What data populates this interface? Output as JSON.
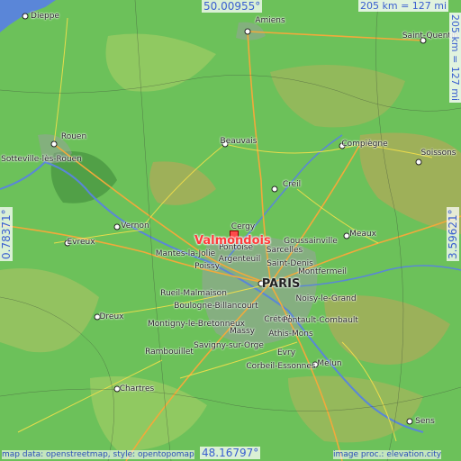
{
  "place": {
    "name": "Valmondois",
    "marker_color": "#ff4a4a"
  },
  "coords": {
    "top": "50.00955°",
    "bottom": "48.16797°",
    "left": "0.78371°",
    "right": "3.59621°"
  },
  "scale": {
    "horizontal": "205 km = 127 mi",
    "vertical": "205 km = 127 mi"
  },
  "attribution": {
    "left": "map data: openstreetmap, style: opentopomap",
    "right": "image proc.: elevation.city"
  },
  "cities": [
    {
      "name": "Dieppe"
    },
    {
      "name": "Amiens"
    },
    {
      "name": "Saint-Quentin"
    },
    {
      "name": "Rouen"
    },
    {
      "name": "Sotteville-lès-Rouen"
    },
    {
      "name": "Beauvais"
    },
    {
      "name": "Compiègne"
    },
    {
      "name": "Soissons"
    },
    {
      "name": "Creil"
    },
    {
      "name": "Vernon"
    },
    {
      "name": "Evreux"
    },
    {
      "name": "Mantes-la-Jolie"
    },
    {
      "name": "Pontoise"
    },
    {
      "name": "Cergy"
    },
    {
      "name": "Sarcelles"
    },
    {
      "name": "Goussainville"
    },
    {
      "name": "Argenteuil"
    },
    {
      "name": "Saint-Denis"
    },
    {
      "name": "Montfermeil"
    },
    {
      "name": "Meaux"
    },
    {
      "name": "Poissy"
    },
    {
      "name": "PARIS"
    },
    {
      "name": "Rueil-Malmaison"
    },
    {
      "name": "Noisy-le-Grand"
    },
    {
      "name": "Boulogne-Billancourt"
    },
    {
      "name": "Créteil"
    },
    {
      "name": "Dreux"
    },
    {
      "name": "Montigny-le-Bretonneux"
    },
    {
      "name": "Massy"
    },
    {
      "name": "Pontault-Combault"
    },
    {
      "name": "Athis-Mons"
    },
    {
      "name": "Rambouillet"
    },
    {
      "name": "Savigny-sur-Orge"
    },
    {
      "name": "Evry"
    },
    {
      "name": "Corbeil-Essonnes"
    },
    {
      "name": "Melun"
    },
    {
      "name": "Chartres"
    },
    {
      "name": "Sens"
    }
  ],
  "colors": {
    "lowland": "#6cc15a",
    "hills": "#c9a25a",
    "urban": "#9aa0a0",
    "roads_major": "#f2a93b",
    "roads_minor": "#f5e04a",
    "water": "#5a86d8",
    "coord_text": "#3a5fd0"
  }
}
